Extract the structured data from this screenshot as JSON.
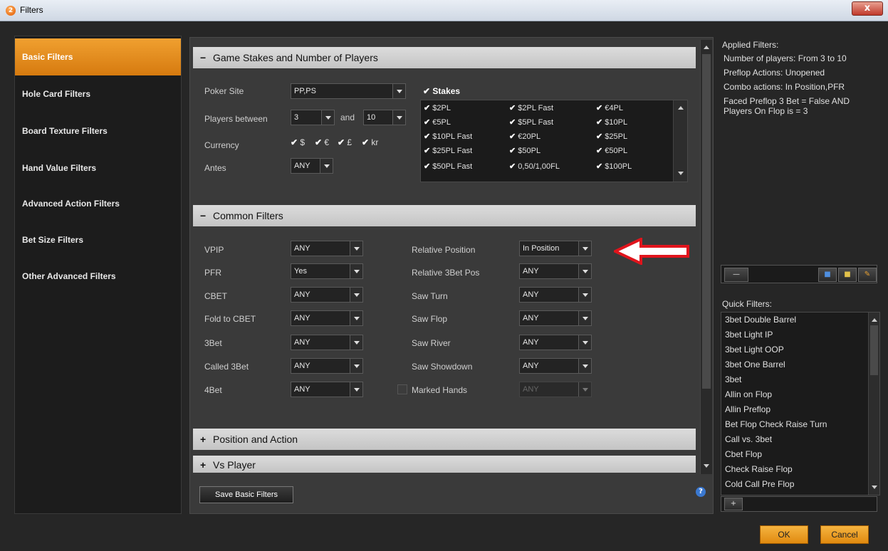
{
  "window": {
    "title": "Filters",
    "close_label": "x"
  },
  "nav": {
    "items": [
      {
        "label": "Basic Filters"
      },
      {
        "label": "Hole Card Filters"
      },
      {
        "label": "Board Texture Filters"
      },
      {
        "label": "Hand Value Filters"
      },
      {
        "label": "Advanced Action Filters"
      },
      {
        "label": "Bet Size Filters"
      },
      {
        "label": "Other Advanced Filters"
      }
    ],
    "active": "Basic Filters"
  },
  "game_stakes": {
    "header": "Game Stakes and Number of Players",
    "poker_site_label": "Poker Site",
    "poker_site_value": "PP,PS",
    "players_between_label": "Players between",
    "players_min": "3",
    "and_label": "and",
    "players_max": "10",
    "currency_label": "Currency",
    "currencies": [
      "$",
      "€",
      "£",
      "kr"
    ],
    "antes_label": "Antes",
    "antes_value": "ANY",
    "stakes_label": "Stakes",
    "stakes": [
      [
        "$2PL",
        "$2PL Fast",
        "€4PL"
      ],
      [
        "€5PL",
        "$5PL Fast",
        "$10PL"
      ],
      [
        "$10PL Fast",
        "€20PL",
        "$25PL"
      ],
      [
        "$25PL Fast",
        "$50PL",
        "€50PL"
      ],
      [
        "$50PL Fast",
        "0,50/1,00FL",
        "$100PL"
      ]
    ]
  },
  "common_filters": {
    "header": "Common Filters",
    "left": [
      {
        "label": "VPIP",
        "value": "ANY"
      },
      {
        "label": "PFR",
        "value": "Yes"
      },
      {
        "label": "CBET",
        "value": "ANY"
      },
      {
        "label": "Fold to CBET",
        "value": "ANY"
      },
      {
        "label": "3Bet",
        "value": "ANY"
      },
      {
        "label": "Called 3Bet",
        "value": "ANY"
      },
      {
        "label": "4Bet",
        "value": "ANY"
      }
    ],
    "right": [
      {
        "label": "Relative Position",
        "value": "In Position"
      },
      {
        "label": "Relative 3Bet Pos",
        "value": "ANY"
      },
      {
        "label": "Saw Turn",
        "value": "ANY"
      },
      {
        "label": "Saw Flop",
        "value": "ANY"
      },
      {
        "label": "Saw River",
        "value": "ANY"
      },
      {
        "label": "Saw Showdown",
        "value": "ANY"
      }
    ],
    "marked_hands_label": "Marked Hands",
    "marked_hands_value": "ANY"
  },
  "collapsed_sections": [
    "Position and Action",
    "Vs Player"
  ],
  "save_button": "Save Basic Filters",
  "applied_filters": {
    "title": "Applied Filters:",
    "items": [
      "Number of players: From 3 to 10",
      "Preflop Actions: Unopened",
      "Combo actions: In Position,PFR",
      "Faced Preflop 3 Bet = False AND Players On Flop is = 3"
    ]
  },
  "quick_filters": {
    "title": "Quick Filters:",
    "items": [
      "3bet Double Barrel",
      "3bet Light IP",
      "3bet Light OOP",
      "3bet One Barrel",
      "3bet",
      "Allin on Flop",
      "Allin Preflop",
      "Bet Flop Check Raise Turn",
      "Call vs. 3bet",
      "Cbet Flop",
      "Check Raise Flop",
      "Cold Call Pre Flop"
    ]
  },
  "footer": {
    "ok": "OK",
    "cancel": "Cancel"
  },
  "colors": {
    "accent": "#e8901c",
    "annotation_arrow": "#e0141c"
  }
}
